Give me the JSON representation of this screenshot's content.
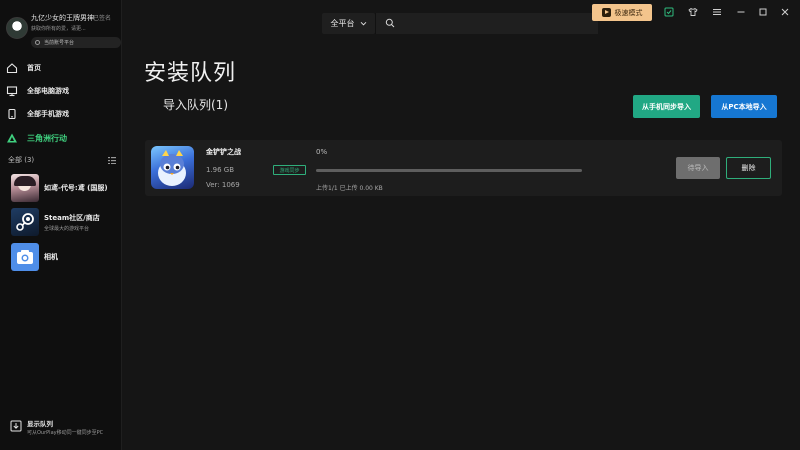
{
  "colors": {
    "accent_green": "#2fbd7e",
    "accent_blue": "#1677d2",
    "active_nav": "#3fd07f",
    "speed_mode_bg": "#f3c48c",
    "background": "#151515",
    "card": "#1d1d1d"
  },
  "profile": {
    "username": "九亿少女的王牌男神",
    "vip_tag": "已签名",
    "signature": "获取你所有的爱，请更...",
    "status": "当前账号平台",
    "avatar_icon": "astronaut-avatar"
  },
  "nav": {
    "home": "首页",
    "pc_games": "全部电脑游戏",
    "mobile_games": "全部手机游戏",
    "featured": "三角洲行动"
  },
  "library": {
    "section_label": "全部 (3)",
    "games": [
      {
        "title": "如鸢-代号:鸢 (国服)",
        "subtitle": "",
        "icon": "game-avatar"
      },
      {
        "title": "Steam社区/商店",
        "subtitle": "全球最大的游戏平台",
        "icon": "steam-icon"
      },
      {
        "title": "相机",
        "subtitle": "",
        "icon": "camera-icon"
      }
    ]
  },
  "footer": {
    "title": "显示队列",
    "subtitle": "可从OurPlay移动同一键同步至PC"
  },
  "topbar": {
    "platform": "全平台",
    "search_placeholder": "",
    "speed_mode": "极速模式"
  },
  "main": {
    "page_title": "安装队列",
    "queue_heading": "导入队列(1)",
    "btn_from_phone": "从手机同步导入",
    "btn_from_pc": "从PC本地导入"
  },
  "task": {
    "name": "金铲铲之战",
    "size": "1.96 GB",
    "version": "Ver: 1069",
    "badge": "游戏同步",
    "percent_text": "0%",
    "progress": 0,
    "info": "上传1/1 已上传 0.00 KB",
    "btn_pending": "待导入",
    "btn_delete": "删除"
  }
}
